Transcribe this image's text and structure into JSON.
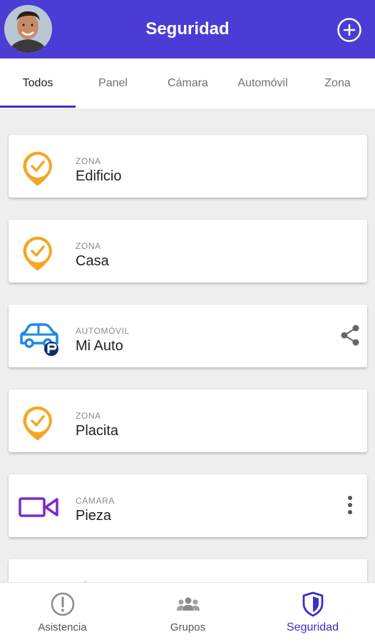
{
  "header": {
    "title": "Seguridad",
    "add_icon": "plus-circle-icon",
    "avatar_icon": "user-avatar"
  },
  "tabs": [
    {
      "label": "Todos",
      "active": true
    },
    {
      "label": "Panel",
      "active": false
    },
    {
      "label": "Cámara",
      "active": false
    },
    {
      "label": "Automóvil",
      "active": false
    },
    {
      "label": "Zona",
      "active": false
    }
  ],
  "devices": [
    {
      "type": "ZONA",
      "name": "Edificio",
      "icon": "zone-pin-check-icon",
      "action": ""
    },
    {
      "type": "ZONA",
      "name": "Casa",
      "icon": "zone-pin-check-icon",
      "action": ""
    },
    {
      "type": "AUTOMÓVIL",
      "name": "Mi Auto",
      "icon": "car-icon",
      "action": "share-icon"
    },
    {
      "type": "ZONA",
      "name": "Placita",
      "icon": "zone-pin-check-icon",
      "action": ""
    },
    {
      "type": "CÁMARA",
      "name": "Pieza",
      "icon": "video-camera-icon",
      "action": "more-vert-icon"
    },
    {
      "type": "CÁMARA",
      "name": "",
      "icon": "video-camera-icon",
      "action": ""
    }
  ],
  "bottom_nav": [
    {
      "label": "Asistencia",
      "icon": "alert-circle-icon",
      "active": false
    },
    {
      "label": "Grupos",
      "icon": "group-icon",
      "active": false
    },
    {
      "label": "Seguridad",
      "icon": "shield-icon",
      "active": true
    }
  ],
  "colors": {
    "primary": "#4c3cd6",
    "active_nav": "#3b30cc",
    "zone_orange": "#f5a623",
    "car_blue": "#1e88e5",
    "camera_purple": "#7b2cbf"
  }
}
